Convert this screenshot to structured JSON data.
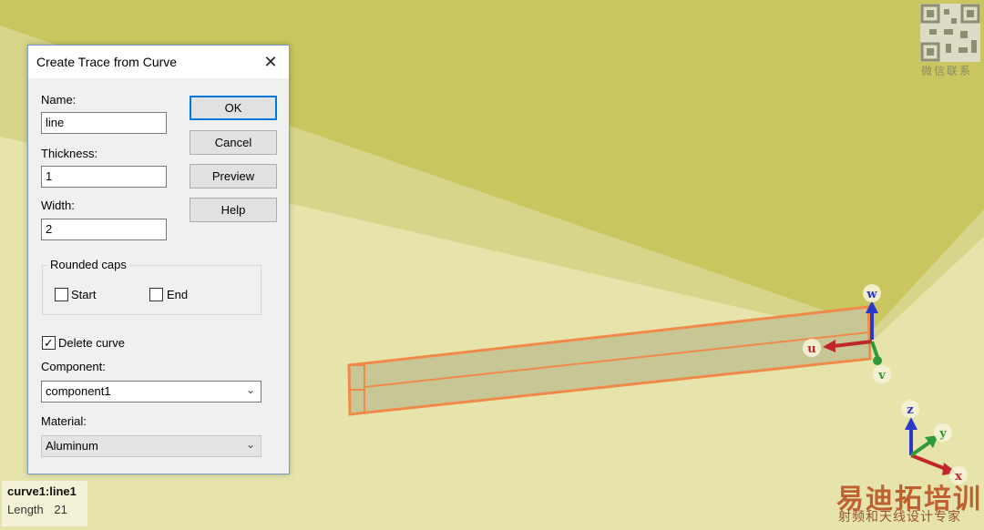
{
  "dialog": {
    "title": "Create Trace from Curve",
    "name_label": "Name:",
    "name_value": "line",
    "thickness_label": "Thickness:",
    "thickness_value": "1",
    "width_label": "Width:",
    "width_value": "2",
    "buttons": {
      "ok": "OK",
      "cancel": "Cancel",
      "preview": "Preview",
      "help": "Help"
    },
    "rounded_caps": {
      "title": "Rounded caps",
      "start_label": "Start",
      "start_checked": false,
      "end_label": "End",
      "end_checked": false
    },
    "delete_curve_label": "Delete curve",
    "delete_curve_checked": true,
    "component_label": "Component:",
    "component_value": "component1",
    "material_label": "Material:",
    "material_value": "Aluminum"
  },
  "status": {
    "name": "curve1:line1",
    "length_label": "Length",
    "length_value": "21"
  },
  "local_axes": {
    "u": "u",
    "v": "v",
    "w": "w"
  },
  "global_axes": {
    "x": "x",
    "y": "y",
    "z": "z"
  },
  "watermark": {
    "qr_caption": "微信联系",
    "logo": "易迪拓培训",
    "logo_sub": "射频和天线设计专家"
  },
  "colors": {
    "trace_outline": "#f08a4b",
    "axis_red": "#c0262a",
    "axis_green": "#2f9a3a",
    "axis_blue": "#2a37c8",
    "dialog_accent": "#0078d7"
  }
}
